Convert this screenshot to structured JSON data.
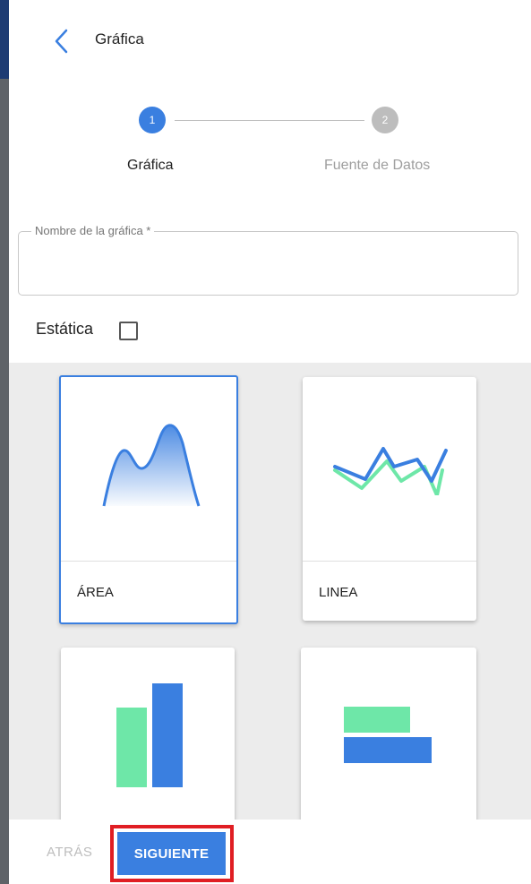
{
  "header": {
    "title": "Gráfica",
    "back_icon": "chevron-left-icon"
  },
  "stepper": {
    "steps": [
      {
        "number": "1",
        "label": "Gráfica",
        "active": true
      },
      {
        "number": "2",
        "label": "Fuente de Datos",
        "active": false
      }
    ]
  },
  "form": {
    "name_field_label": "Nombre de la gráfica *",
    "name_field_value": "",
    "static_label": "Estática",
    "static_checked": false
  },
  "chart_types": [
    {
      "label": "ÁREA",
      "icon": "area-chart-icon",
      "selected": true
    },
    {
      "label": "LINEA",
      "icon": "line-chart-icon",
      "selected": false
    },
    {
      "label": "",
      "icon": "bar-chart-icon",
      "selected": false
    },
    {
      "label": "",
      "icon": "horizontal-bar-chart-icon",
      "selected": false
    }
  ],
  "footer": {
    "back_label": "ATRÁS",
    "next_label": "SIGUIENTE"
  },
  "colors": {
    "primary": "#3a7fe0",
    "accent_green": "#6ee7a8",
    "inactive": "#bdbdbd",
    "highlight": "#e01e23"
  }
}
